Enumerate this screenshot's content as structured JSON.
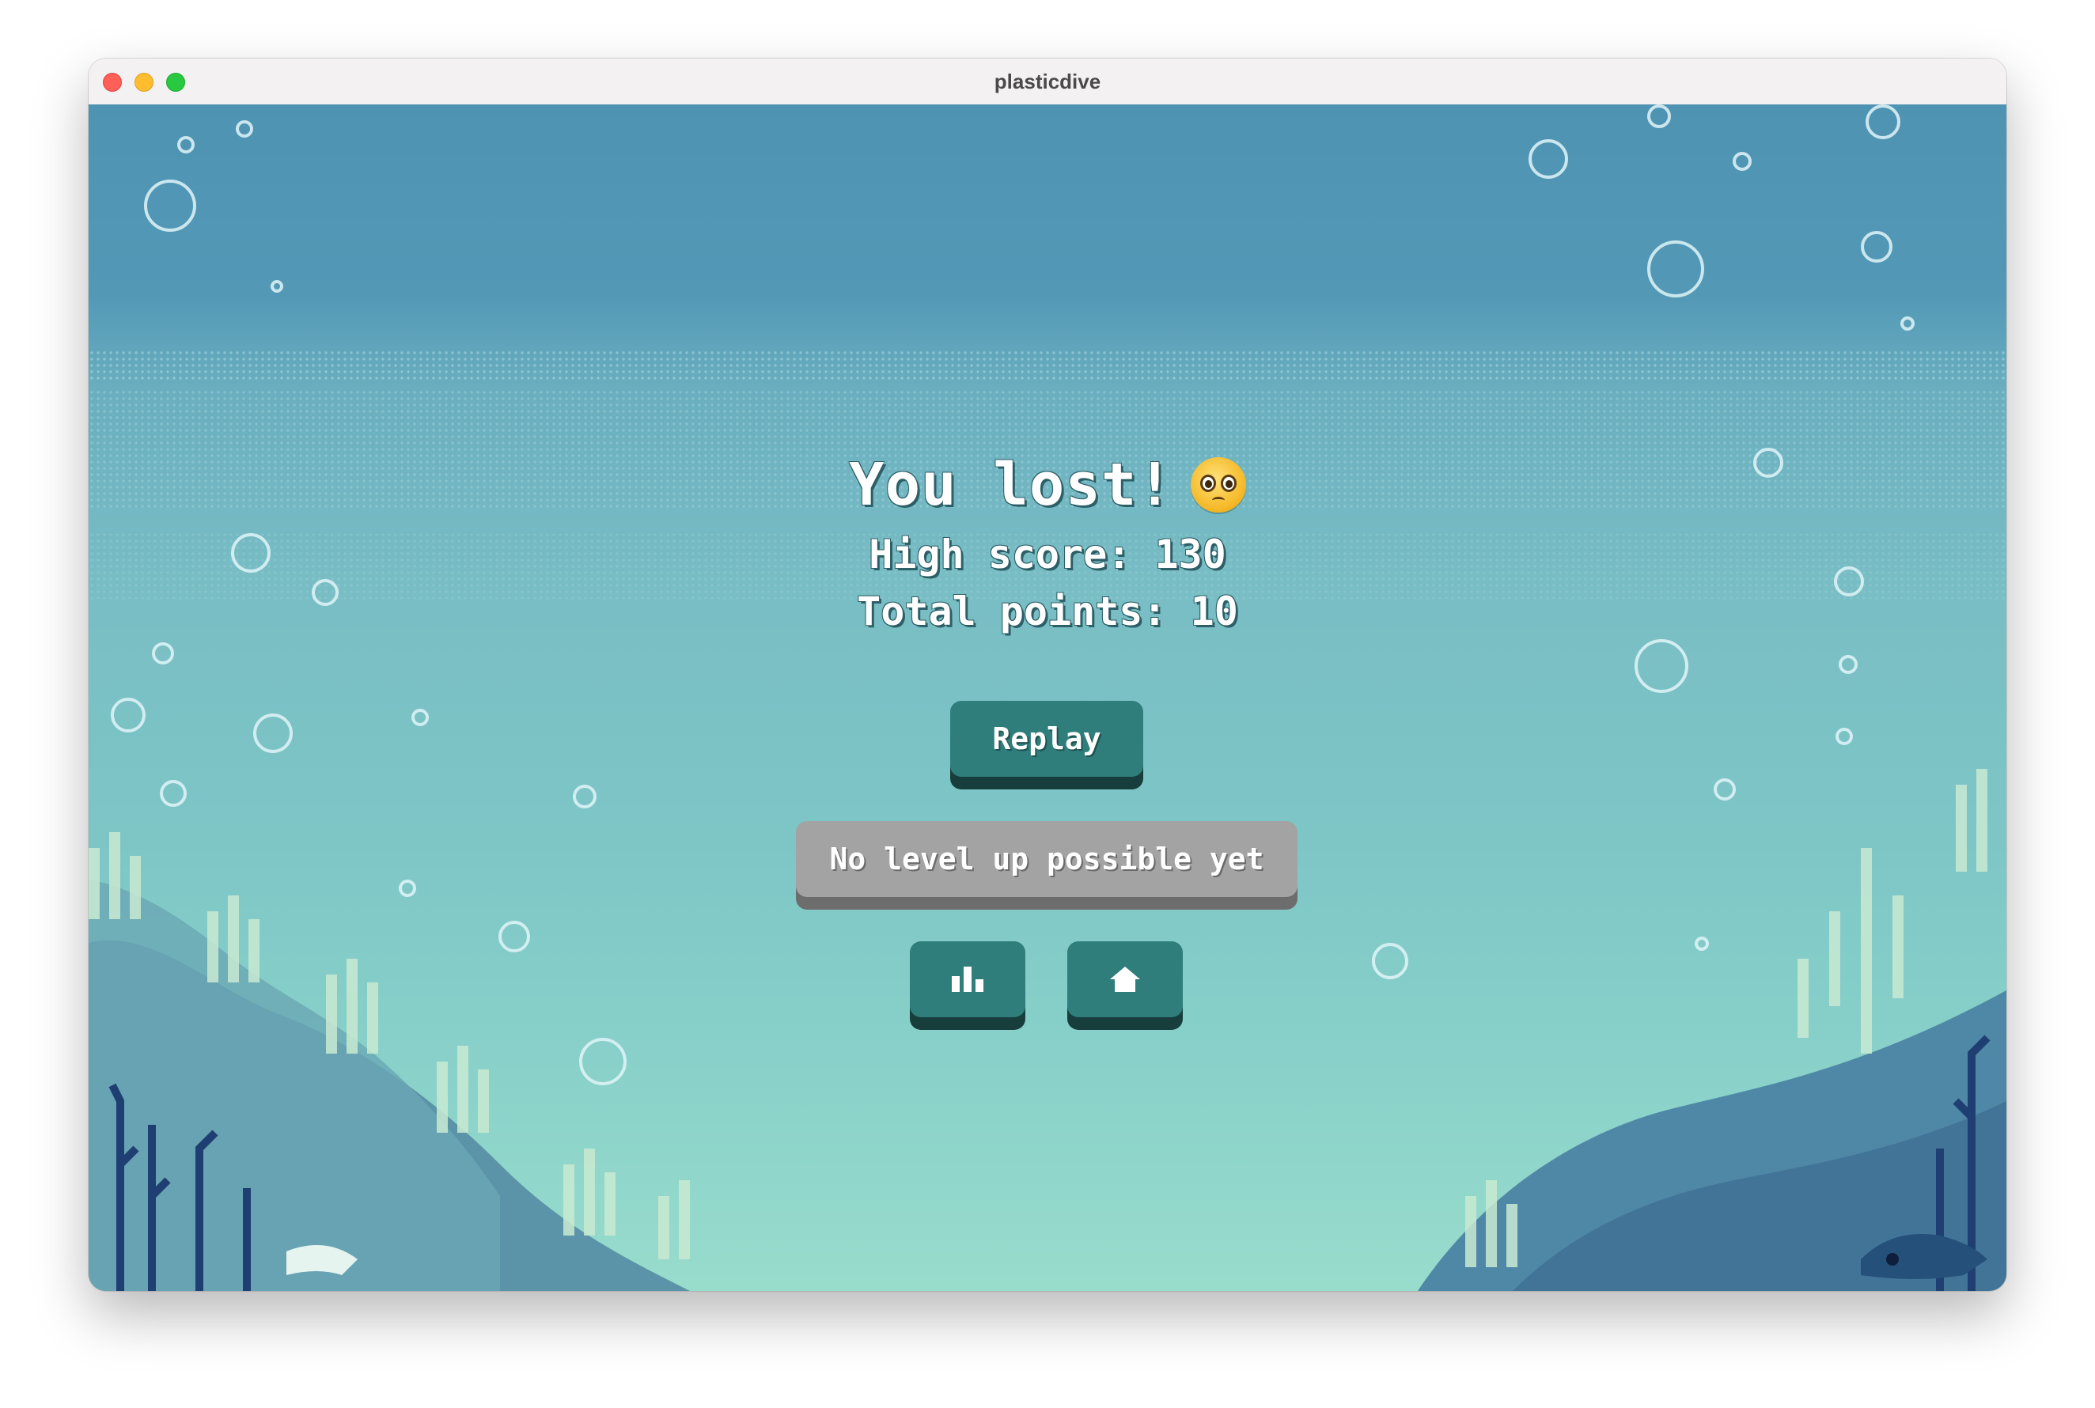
{
  "window": {
    "title": "plasticdive"
  },
  "game_over": {
    "headline": "You lost!",
    "emoji": "pleading-face",
    "high_score_text": "High score: 130",
    "total_points_text": "Total points: 10"
  },
  "buttons": {
    "replay_label": "Replay",
    "level_up_label": "No level up possible yet",
    "stats_icon": "bar-chart-icon",
    "home_icon": "home-icon"
  },
  "colors": {
    "button_teal": "#2f7e7c",
    "button_disabled": "#a3a3a3",
    "water_top": "#4f93b3",
    "water_bottom": "#98dccc"
  }
}
